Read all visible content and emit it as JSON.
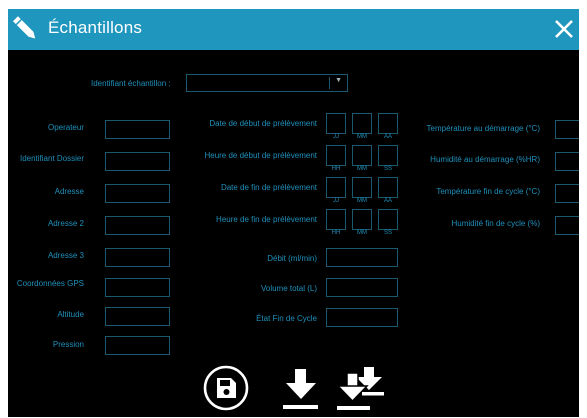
{
  "window": {
    "title": "Échantillons"
  },
  "sample_id": {
    "label": "Identifiant échantillon :",
    "value": ""
  },
  "left_fields": [
    {
      "label": "Operateur",
      "value": ""
    },
    {
      "label": "Identifiant Dossier",
      "value": ""
    },
    {
      "label": "Adresse",
      "value": ""
    },
    {
      "label": "Adresse 2",
      "value": ""
    },
    {
      "label": "Adresse 3",
      "value": ""
    },
    {
      "label": "Coordonnées GPS",
      "value": ""
    },
    {
      "label": "Altitude",
      "value": ""
    },
    {
      "label": "Pression",
      "value": ""
    }
  ],
  "datetime_fields": [
    {
      "label": "Date de début de prélèvement",
      "units": [
        "JJ",
        "MM",
        "AA"
      ]
    },
    {
      "label": "Heure de début de prélèvement",
      "units": [
        "HH",
        "MM",
        "SS"
      ]
    },
    {
      "label": "Date de fin de prélèvement",
      "units": [
        "JJ",
        "MM",
        "AA"
      ]
    },
    {
      "label": "Heure de fin de prélèvement",
      "units": [
        "HH",
        "MM",
        "SS"
      ]
    }
  ],
  "mid_fields": [
    {
      "label": "Débit (ml/min)",
      "value": ""
    },
    {
      "label": "Volume total (L)",
      "value": ""
    },
    {
      "label": "État Fin de Cycle",
      "value": ""
    }
  ],
  "right_fields": [
    {
      "label": "Température au démarrage (°C)",
      "value": ""
    },
    {
      "label": "Humidité au démarrage (%HR)",
      "value": ""
    },
    {
      "label": "Température fin de cycle (°C)",
      "value": ""
    },
    {
      "label": "Humidité fin de cycle (%)",
      "value": ""
    }
  ],
  "actions": [
    {
      "name": "save-icon"
    },
    {
      "name": "download-icon"
    },
    {
      "name": "download-all-icon"
    }
  ],
  "colors": {
    "titlebar": "#1f96bd",
    "label": "#1f90bb",
    "field_border": "#1b5a6e",
    "background": "#000000"
  }
}
